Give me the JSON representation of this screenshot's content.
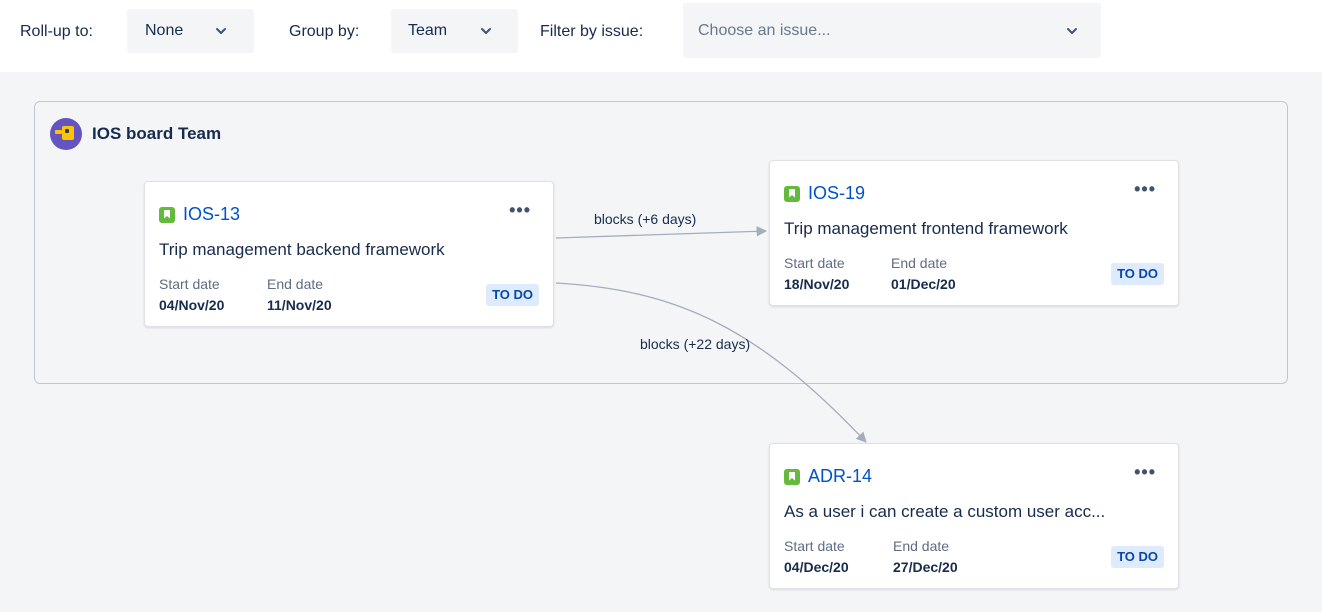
{
  "toolbar": {
    "rollup_label": "Roll-up to:",
    "rollup_value": "None",
    "groupby_label": "Group by:",
    "groupby_value": "Team",
    "filter_label": "Filter by issue:",
    "filter_placeholder": "Choose an issue..."
  },
  "group": {
    "title": "IOS board Team",
    "avatar_icon": "team-avatar-icon"
  },
  "cards": [
    {
      "key": "IOS-13",
      "summary": "Trip management backend framework",
      "start_label": "Start date",
      "start_value": "04/Nov/20",
      "end_label": "End date",
      "end_value": "11/Nov/20",
      "status": "TO DO",
      "more": "•••"
    },
    {
      "key": "IOS-19",
      "summary": "Trip management frontend framework",
      "start_label": "Start date",
      "start_value": "18/Nov/20",
      "end_label": "End date",
      "end_value": "01/Dec/20",
      "status": "TO DO",
      "more": "•••"
    },
    {
      "key": "ADR-14",
      "summary": "As a user i can create a custom user acc...",
      "start_label": "Start date",
      "start_value": "04/Dec/20",
      "end_label": "End date",
      "end_value": "27/Dec/20",
      "status": "TO DO",
      "more": "•••"
    }
  ],
  "edges": [
    {
      "label": "blocks (+6 days)"
    },
    {
      "label": "blocks (+22 days)"
    }
  ],
  "colors": {
    "link": "#0052cc",
    "story": "#63ba3c",
    "status_bg": "#deebff",
    "status_text": "#0747a6",
    "avatar": "#6554c0"
  }
}
